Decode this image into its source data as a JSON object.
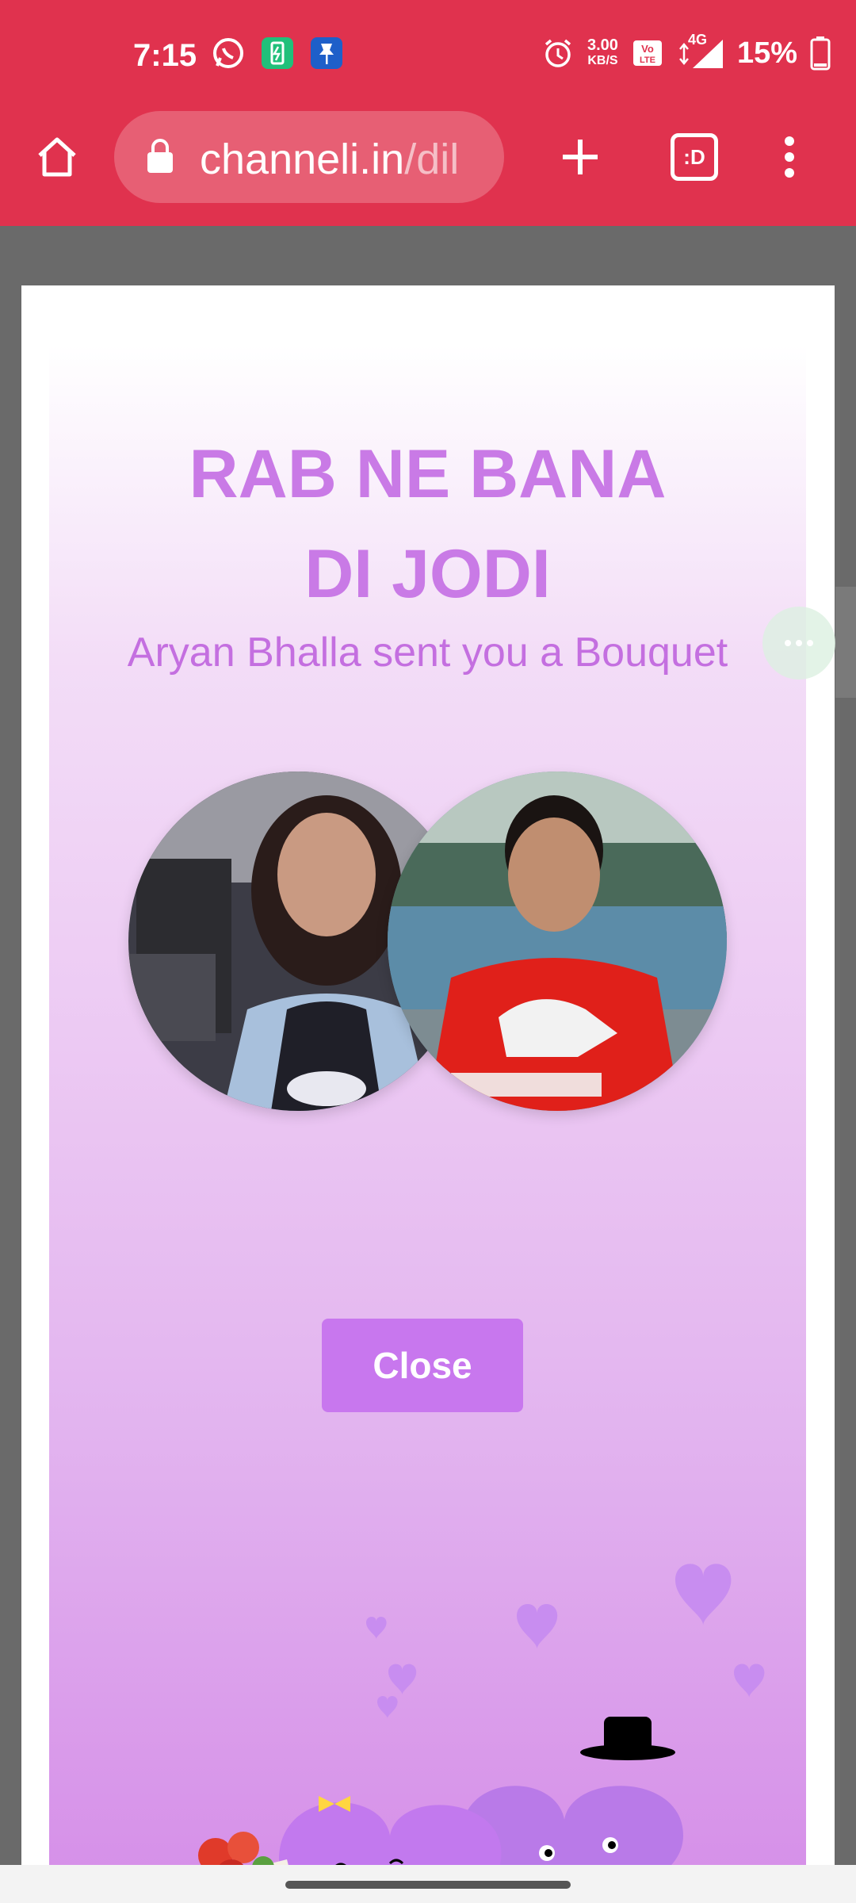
{
  "status_bar": {
    "time": "7:15",
    "net_speed_value": "3.00",
    "net_speed_unit": "KB/S",
    "network": "4G",
    "battery": "15%",
    "icons": [
      "whatsapp-icon",
      "battery-saver-icon",
      "pin-icon",
      "alarm-icon",
      "volte-icon",
      "signal-icon",
      "battery-icon"
    ]
  },
  "browser": {
    "url_host": "channeli.in",
    "url_path": "/dil",
    "tab_label": ":D"
  },
  "card": {
    "title_line1": "RAB NE BANA",
    "title_line2": "DI JODI",
    "subtitle": "Aryan Bhalla sent you a Bouquet",
    "close_label": "Close"
  },
  "colors": {
    "browser_bar": "#e0324e",
    "accent": "#c97ae6",
    "button": "#c877ee"
  }
}
